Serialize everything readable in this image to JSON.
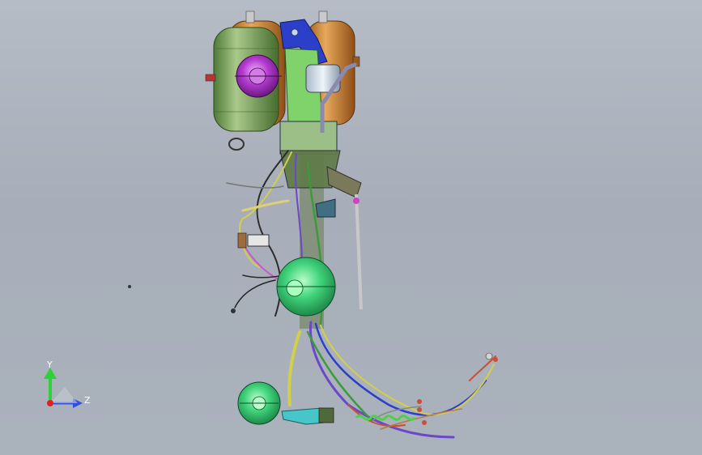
{
  "viewport": {
    "background_top": "#b6bcc6",
    "background_bottom": "#aab2bc"
  },
  "triad": {
    "y_label": "Y",
    "z_label": "Z",
    "y_color": "#2fd13a",
    "z_color": "#2f4fe0",
    "x_color": "#e02020"
  },
  "parts": {
    "tank_left_color": "#6f9a4e",
    "tank_right_color": "#c57a2c",
    "chamber_color": "#3fd27a",
    "actuator_color": "#b43bd0",
    "frame_color": "#2b3fc8",
    "bracket_color": "#46c6c8"
  }
}
